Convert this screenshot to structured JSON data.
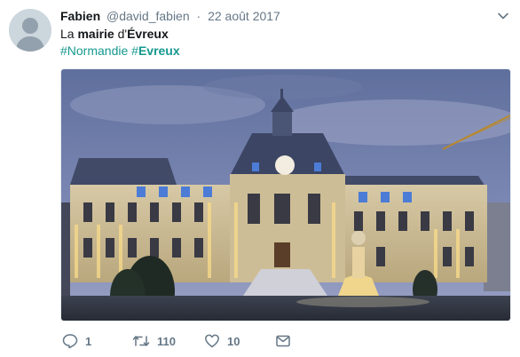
{
  "author": {
    "name": "Fabien",
    "handle": "@david_fabien",
    "separator": "·",
    "date": "22 août 2017"
  },
  "tweet": {
    "text_part1": "La ",
    "text_bold1": "mairie",
    "text_part2": " d'",
    "text_bold2": "Évreux",
    "hashtag1": "#Normandie",
    "hashtag2_prefix": "#",
    "hashtag2_bold": "Evreux"
  },
  "actions": {
    "reply_count": "1",
    "retweet_count": "110",
    "like_count": "10",
    "reply_icon": "reply-icon",
    "retweet_icon": "retweet-icon",
    "like_icon": "heart-icon",
    "dm_icon": "envelope-icon"
  },
  "colors": {
    "hashtag": "#16998f",
    "secondary_text": "#657786",
    "primary_text": "#14171a"
  }
}
